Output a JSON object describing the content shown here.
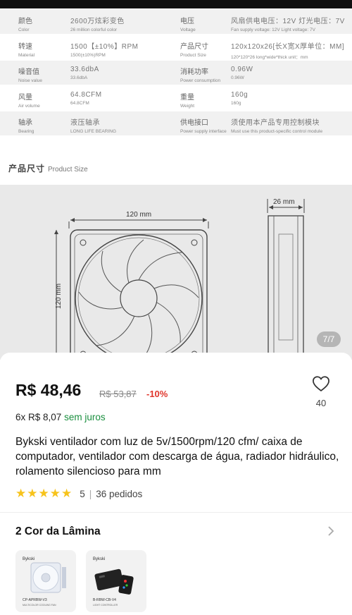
{
  "specs": [
    {
      "zh1": "颜色",
      "en1": "Color",
      "zhv1": "2600万炫彩变色",
      "env1": "26 million colorful color",
      "zh2": "电压",
      "en2": "Voltage",
      "zhv2": "风扇供电电压：12V 灯光电压：7V",
      "env2": "Fan supply voltage: 12V Light voltage: 7V"
    },
    {
      "zh1": "转速",
      "en1": "Material",
      "zhv1": "1500【±10%】RPM",
      "env1": "1500(±10%)RPM",
      "zh2": "产品尺寸",
      "en2": "Product Size",
      "zhv2": "120x120x26[长X宽X厚单位：MM]",
      "env2": "120*120*26 long*wide*thick unit：mm"
    },
    {
      "zh1": "噪音值",
      "en1": "Noise value",
      "zhv1": "33.6dbA",
      "env1": "33.6dbA",
      "zh2": "消耗功率",
      "en2": "Power consumption",
      "zhv2": "0.96W",
      "env2": "0.96W"
    },
    {
      "zh1": "风量",
      "en1": "Air volume",
      "zhv1": "64.8CFM",
      "env1": "64.8CFM",
      "zh2": "重量",
      "en2": "Weight",
      "zhv2": "160g",
      "env2": "160g"
    },
    {
      "zh1": "轴承",
      "en1": "Bearing",
      "zhv1": "液压轴承",
      "env1": "LONG LIFE BEARING",
      "zh2": "供电接口",
      "en2": "Power supply interface",
      "zhv2": "须使用本产品专用控制模块",
      "env2": "Must use this product-specific control module"
    }
  ],
  "section": {
    "title_zh": "产品尺寸",
    "title_en": "Product Size"
  },
  "drawing": {
    "width_label": "120 mm",
    "height_label": "120 mm",
    "depth_label": "26 mm",
    "page_indicator": "7/7"
  },
  "product": {
    "price": "R$ 48,46",
    "old_price": "R$ 53,87",
    "discount": "-10%",
    "wishlist_count": "40",
    "installments": "6x R$ 8,07",
    "installments_free": "sem juros",
    "title": "Bykski ventilador com luz de 5v/1500rpm/120 cfm/ caixa de computador, ventilador com descarga de água, radiador hidráulico, rolamento silencioso para mm",
    "stars": "★★★★★",
    "rating": "5",
    "separator": "|",
    "orders": "36 pedidos",
    "color_title": "2 Cor da Lâmina",
    "colors": [
      {
        "brand": "Bykski",
        "caption": "CP-APRBW-V3",
        "sub": "MULTICOLOR COOLING FAN"
      },
      {
        "brand": "Bykski",
        "caption": "B-RBW-CB-V4",
        "sub": "LIGHT CONTROLLER"
      }
    ]
  },
  "colors": {
    "price_red": "#e0362c",
    "free_green": "#1a8f3f",
    "star_yellow": "#f7c31b"
  },
  "icons": {
    "wishlist": "heart-outline-icon",
    "chevron": "chevron-right-icon"
  }
}
